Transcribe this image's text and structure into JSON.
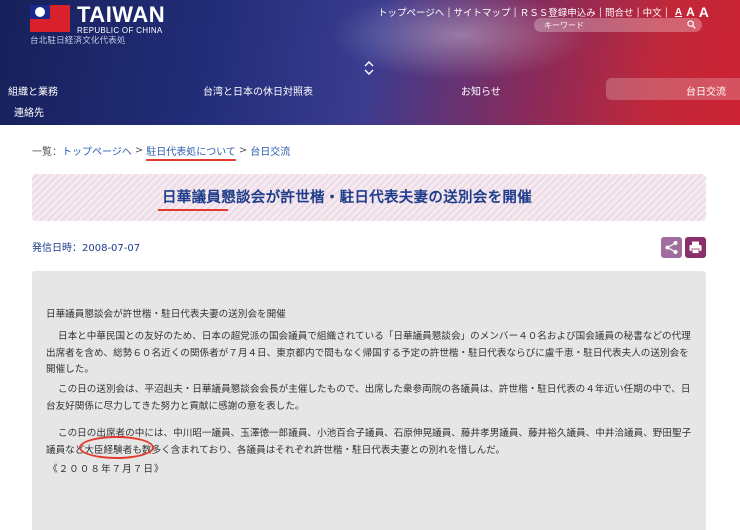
{
  "header": {
    "logo_main": "TAIWAN",
    "logo_sub": "REPUBLIC OF CHINA",
    "org_name": "台北駐日経済文化代表処",
    "links": [
      "トップページへ",
      "サイトマップ",
      "ＲＳＳ登録申込み",
      "問合せ",
      "中文"
    ],
    "font_sizes": [
      "A",
      "A",
      "A"
    ],
    "search_placeholder": "キーワード",
    "nav": [
      "組織と業務",
      "台湾と日本の休日対照表",
      "お知らせ",
      "台日交流"
    ],
    "nav_row2": "連絡先",
    "active_nav": "台日交流"
  },
  "breadcrumb": {
    "prefix": "一覧：",
    "items": [
      "トップページへ",
      "駐日代表処について",
      "台日交流"
    ],
    "separator": ">"
  },
  "article": {
    "title": "日華議員懇談会が許世楷・駐日代表夫妻の送別会を開催",
    "date": "発信日時：2008-07-07",
    "heading": "日華議員懇談会が許世楷・駐日代表夫妻の送別会を開催",
    "p1": "日本と中華民国との友好のため、日本の超党派の国会議員で組織されている「日華議員懇談会」のメンバー４０名および国会議員の秘書などの代理出席者を含め、総勢６０名近くの関係者が７月４日、東京都内で間もなく帰国する予定の許世楷・駐日代表ならびに盧千恵・駐日代表夫人の送別会を開催した。",
    "p2": "この日の送別会は、平沼赳夫・日華議員懇談会会長が主催したもので、出席した衆参両院の各議員は、許世楷・駐日代表の４年近い任期の中で、日台友好関係に尽力してきた努力と貢献に感謝の意を表した。",
    "p3": "この日の出席者の中には、中川昭一議員、玉澤徳一郎議員、小池百合子議員、石原伸晃議員、藤井孝男議員、藤井裕久議員、中井洽議員、野田聖子議員など大臣経験者も数多く含まれており、各議員はそれぞれ許世楷・駐日代表夫妻との別れを惜しんだ。",
    "dateline": "《２００８年７月７日》"
  },
  "colors": {
    "accent": "#1f3d8a",
    "highlight": "#e23a2c",
    "share_button": "#a06d9e",
    "print_button": "#8a2f6c"
  }
}
